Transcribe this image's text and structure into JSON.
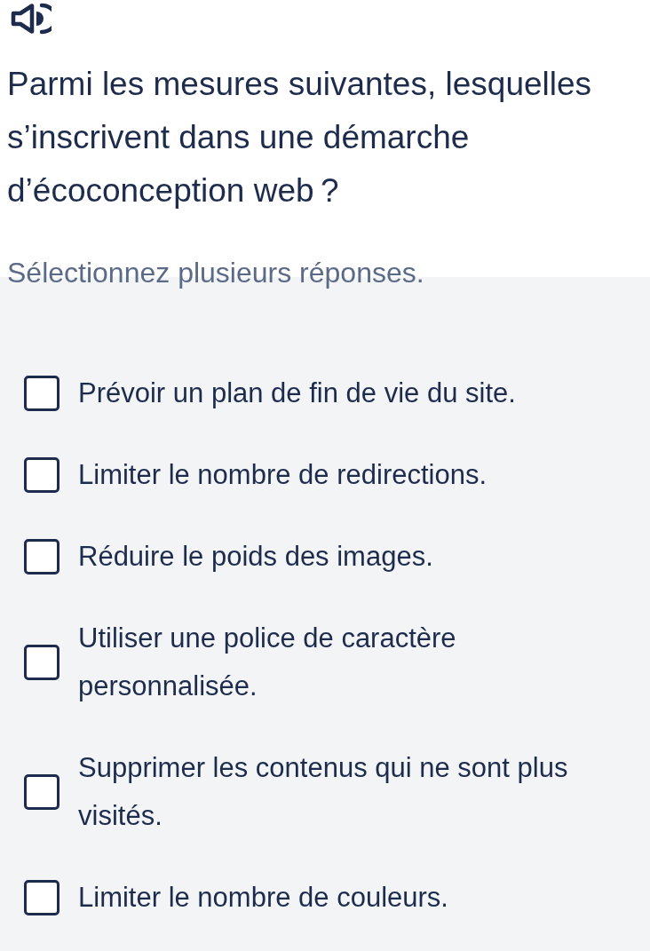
{
  "question": "Parmi les mesures suivantes, lesquelles s’inscrivent dans une démarche d’écoconception web ?",
  "instruction": "Sélectionnez plusieurs réponses.",
  "options": [
    {
      "label": "Prévoir un plan de fin de vie du site.",
      "checked": false
    },
    {
      "label": "Limiter le nombre de redirections.",
      "checked": false
    },
    {
      "label": "Réduire le poids des images.",
      "checked": false
    },
    {
      "label": "Utiliser une police de caractère personnalisée.",
      "checked": false
    },
    {
      "label": "Supprimer les contenus qui ne sont plus visités.",
      "checked": false
    },
    {
      "label": "Limiter le nombre de couleurs.",
      "checked": false
    }
  ]
}
